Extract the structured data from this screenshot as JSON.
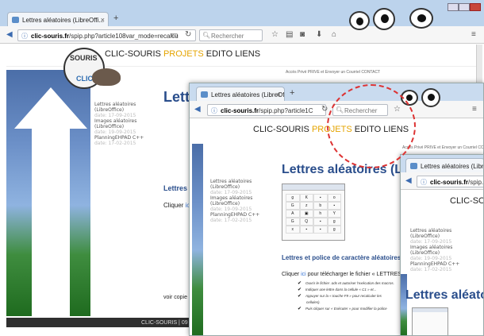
{
  "w1": {
    "tab": "Lettres aléatoires (LibreOffi...",
    "url_domain": "clic-souris.fr",
    "url_rest": "/spip.php?article108var_mode=recalcu",
    "search": "Rechercher"
  },
  "w2": {
    "tab": "Lettres aléatoires (LibreOffi...",
    "url_domain": "clic-souris.fr",
    "url_rest": "/spip.php?article1C",
    "search": "Rechercher"
  },
  "w3": {
    "tab": "Lettres aléatoires (LibreOffi...",
    "url_domain": "clic-souris.fr",
    "url_rest": "/spip.p"
  },
  "site": {
    "brand": "CLIC-SOURIS",
    "projets": "PROJETS",
    "edito": "EDITO",
    "liens": "LIENS",
    "access": "Accès Privé PRIVE et Envoyer un Courriel CONTACT",
    "side": [
      {
        "t1": "Lettres aléatoires",
        "t2": "(LibreOffice)",
        "date": "date: 17-09-2015"
      },
      {
        "t1": "Images aléatoires",
        "t2": "(LibreOffice)",
        "date": "date: 19-09-2015"
      },
      {
        "t1": "PlanningEHPAD C++",
        "t2": "",
        "date": "date: 17-02-2015"
      }
    ],
    "title": "Lettres aléatoires (LibreOffice)",
    "subtitle": "Lettres et police de caractère aléatoires",
    "click_a": "Cliquer ",
    "click_ici": "ici",
    "click_b": " pour télécharger le fichier « LETTRES-ALEATOIRES ».",
    "bullets": [
      "Ouvrir le fichier .ods et autoriser l'exécution des macros.",
      "Indiquer une lettre dans la cellule « C1 » et...",
      "Appuyer sur la « touche F9 » pour recalculer les",
      "cellules).",
      "Puis cliquer sur « Exécuter » pour modifier la police"
    ],
    "voir": "voir copie",
    "footer": "CLIC-SOURIS | 09",
    "grid": [
      "g",
      "K",
      "▪",
      "o",
      "G",
      "z",
      "b",
      "▪",
      "A",
      "▣",
      "h",
      "Y",
      "G",
      "Q",
      "▪",
      "g",
      "x",
      "▪",
      "▪",
      "g"
    ]
  },
  "logo": {
    "t1": "SOURIS",
    "t2": "CLIC"
  }
}
